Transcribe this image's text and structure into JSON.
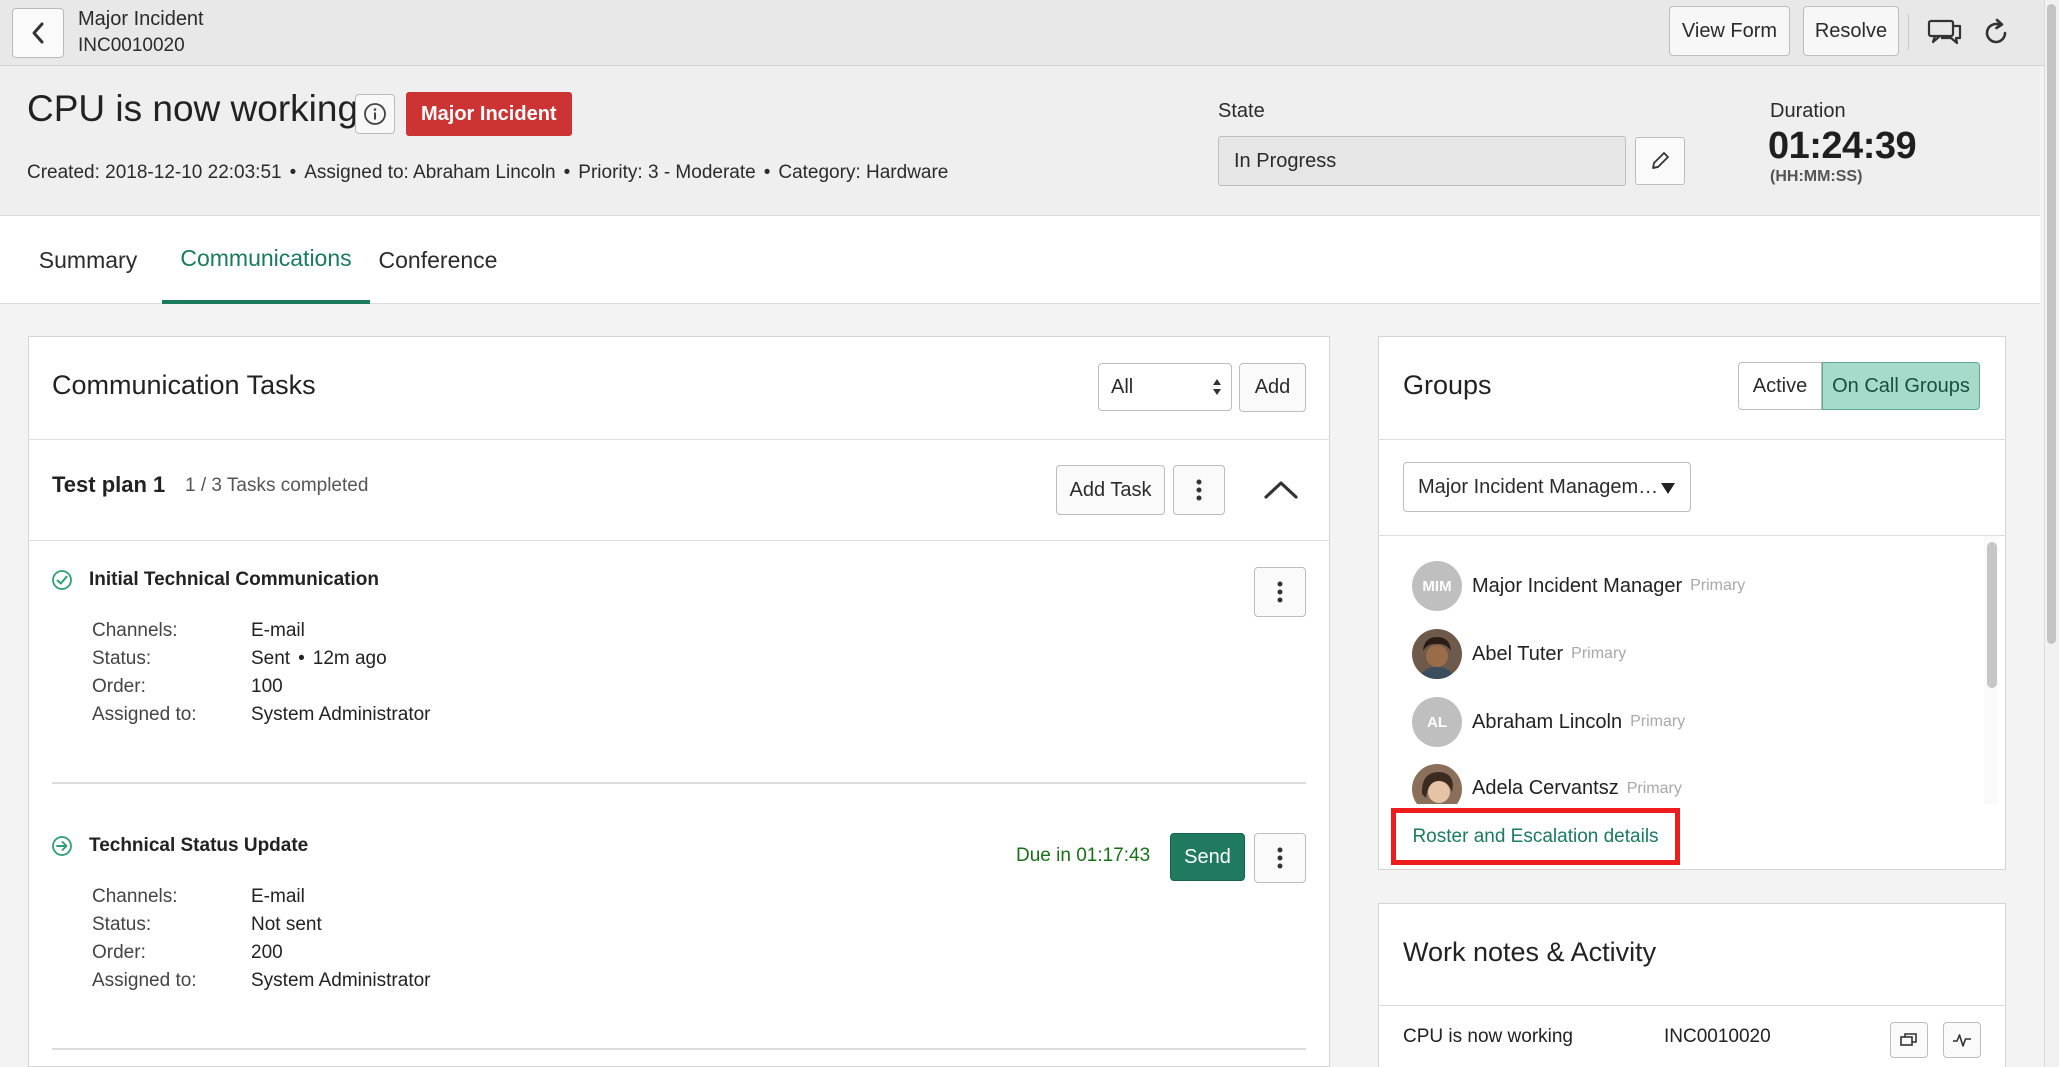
{
  "topbar": {
    "title": "Major Incident",
    "number": "INC0010020",
    "view_form": "View Form",
    "resolve": "Resolve"
  },
  "header": {
    "title": "CPU is now working",
    "badge": "Major Incident",
    "badge_color": "#cc3333",
    "meta": {
      "created": "Created: 2018-12-10 22:03:51",
      "assigned": "Assigned to: Abraham Lincoln",
      "priority": "Priority: 3 - Moderate",
      "category": "Category: Hardware",
      "separator": "•"
    },
    "state": {
      "label": "State",
      "value": "In Progress"
    },
    "duration": {
      "label": "Duration",
      "value": "01:24:39",
      "unit": "(HH:MM:SS)"
    }
  },
  "tabs": [
    {
      "label": "Summary"
    },
    {
      "label": "Communications"
    },
    {
      "label": "Conference"
    }
  ],
  "accent_color": "#1a7a5e",
  "communication_tasks": {
    "title": "Communication Tasks",
    "filter": "All",
    "add": "Add",
    "plan": {
      "title": "Test plan 1",
      "count": "1 / 3 Tasks completed",
      "add_task": "Add Task"
    },
    "tasks": [
      {
        "title": "Initial Technical Communication",
        "icon": "check-circle-icon",
        "channels_label": "Channels:",
        "channels": "E-mail",
        "status_label": "Status:",
        "status": "Sent",
        "status_time": "12m ago",
        "order_label": "Order:",
        "order": "100",
        "assigned_label": "Assigned to:",
        "assigned": "System Administrator"
      },
      {
        "title": "Technical Status Update",
        "icon": "arrow-circle-icon",
        "due": "Due in 01:17:43",
        "send": "Send",
        "channels_label": "Channels:",
        "channels": "E-mail",
        "status_label": "Status:",
        "status": "Not sent",
        "order_label": "Order:",
        "order": "200",
        "assigned_label": "Assigned to:",
        "assigned": "System Administrator"
      }
    ]
  },
  "groups": {
    "title": "Groups",
    "toggle_active": "Active",
    "toggle_oncall": "On Call Groups",
    "group_select": "Major Incident Managem…",
    "members": [
      {
        "initials": "MIM",
        "name": "Major Incident Manager",
        "role": "Primary"
      },
      {
        "initials": "",
        "name": "Abel Tuter",
        "role": "Primary"
      },
      {
        "initials": "AL",
        "name": "Abraham Lincoln",
        "role": "Primary"
      },
      {
        "initials": "",
        "name": "Adela Cervantsz",
        "role": "Primary"
      }
    ],
    "roster_link": "Roster and Escalation details"
  },
  "work_notes": {
    "title": "Work notes & Activity",
    "record_title": "CPU is now working",
    "record_number": "INC0010020"
  }
}
